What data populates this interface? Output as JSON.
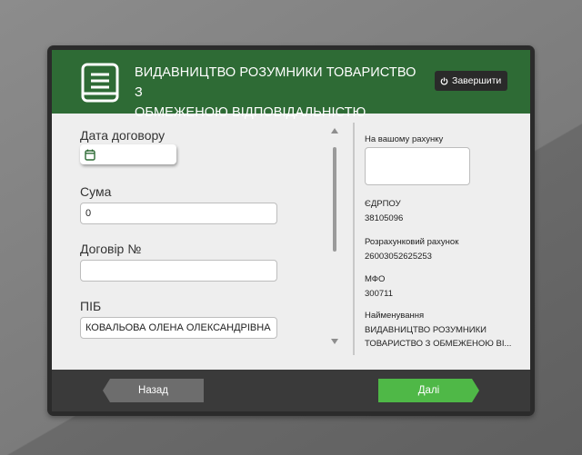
{
  "header": {
    "company_line1": "ВИДАВНИЦТВО РОЗУМНИКИ ТОВАРИСТВО З",
    "company_line2": "ОБМЕЖЕНОЮ ВІДПОВІДАЛЬНІСТЮ",
    "logo_icon": "document-list-icon",
    "finish_label": "Завершити",
    "finish_icon": "power-icon"
  },
  "form": {
    "date": {
      "label": "Дата договору",
      "value": "",
      "icon": "calendar-icon"
    },
    "amount": {
      "label": "Сума",
      "value": "0"
    },
    "contract": {
      "label": "Договір №",
      "value": ""
    },
    "name": {
      "label": "ПІБ",
      "value": "КОВАЛЬОВА ОЛЕНА ОЛЕКСАНДРІВНА"
    }
  },
  "details": {
    "account_label": "На вашому рахунку",
    "account_value": "",
    "edrpou_label": "ЄДРПОУ",
    "edrpou_value": "38105096",
    "settlement_label": "Розрахунковий рахунок",
    "settlement_value": "26003052625253",
    "mfo_label": "МФО",
    "mfo_value": "300711",
    "name_label": "Найменування",
    "name_line1": "ВИДАВНИЦТВО РОЗУМНИКИ",
    "name_line2": "ТОВАРИСТВО З ОБМЕЖЕНОЮ ВІ..."
  },
  "footer": {
    "back_label": "Назад",
    "next_label": "Далі"
  },
  "colors": {
    "header_green": "#2e6b35",
    "next_green": "#4fb847",
    "back_gray": "#6d6d6d",
    "frame_dark": "#2b2b2b"
  }
}
